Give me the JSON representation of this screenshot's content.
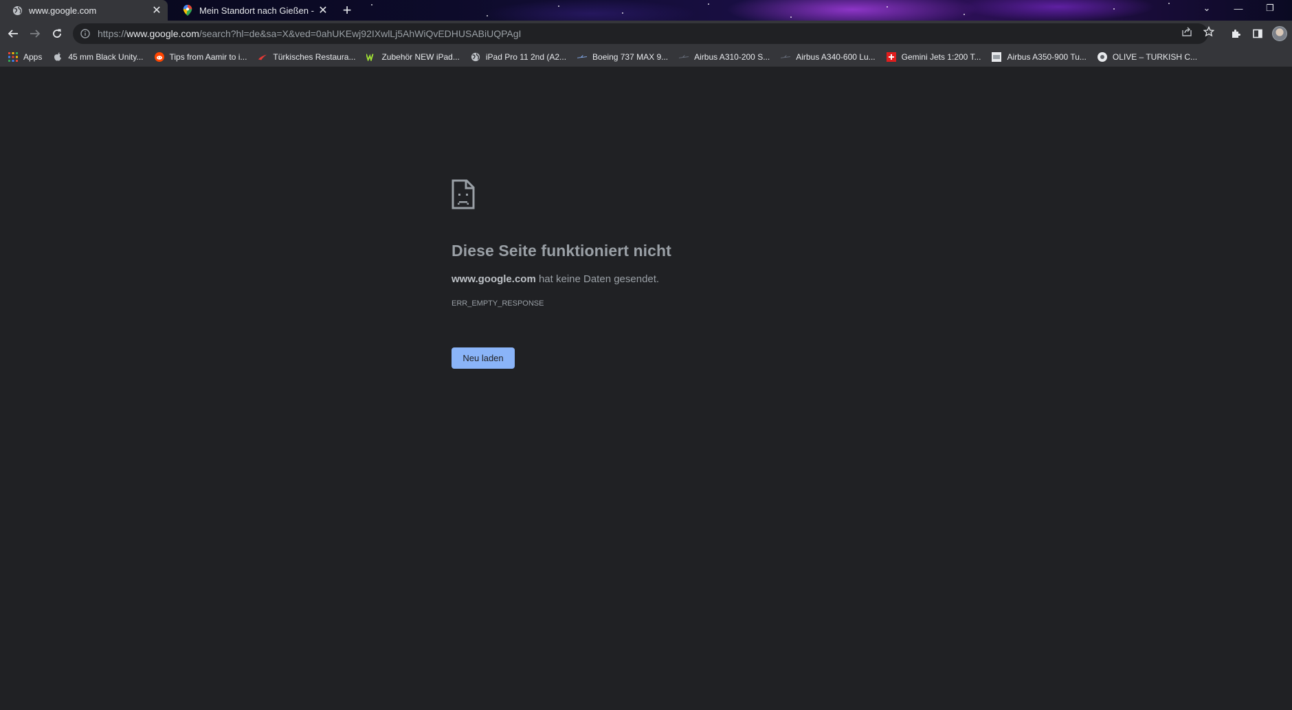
{
  "window": {
    "tabs": [
      {
        "title": "www.google.com",
        "active": true,
        "favicon": "globe-icon",
        "close": "✕"
      },
      {
        "title": "Mein Standort nach Gießen - Goo",
        "active": false,
        "favicon": "google-maps-pin-icon",
        "close": "✕"
      }
    ],
    "new_tab": "+",
    "controls": {
      "tab_search": "⌄",
      "minimize": "—",
      "restore": "❐"
    }
  },
  "toolbar": {
    "url_prefix": "https://",
    "url_host": "www.google.com",
    "url_path": "/search?hl=de&sa=X&ved=0ahUKEwj92IXwlLj5AhWiQvEDHUSABiUQPAgI",
    "icons": [
      "back-icon",
      "forward-icon",
      "reload-icon",
      "info-icon",
      "share-icon",
      "star-icon",
      "extensions-icon",
      "side-panel-icon",
      "profile-avatar"
    ]
  },
  "bookmarks": [
    {
      "label": "Apps",
      "icon": "apps-grid-icon"
    },
    {
      "label": "45 mm Black Unity...",
      "icon": "apple-icon"
    },
    {
      "label": "Tips from Aamir to i...",
      "icon": "reddit-icon"
    },
    {
      "label": "Türkisches Restaura...",
      "icon": "airline-logo-icon"
    },
    {
      "label": "Zubehör NEW iPad...",
      "icon": "w-logo-icon"
    },
    {
      "label": "iPad Pro 11 2nd (A2...",
      "icon": "globe-icon"
    },
    {
      "label": "Boeing 737 MAX 9...",
      "icon": "plane-icon"
    },
    {
      "label": "Airbus A310-200 S...",
      "icon": "plane-icon"
    },
    {
      "label": "Airbus A340-600 Lu...",
      "icon": "plane-icon"
    },
    {
      "label": "Gemini Jets 1:200 T...",
      "icon": "swiss-flag-icon"
    },
    {
      "label": "Airbus A350-900 Tu...",
      "icon": "page-icon"
    },
    {
      "label": "OLIVE – TURKISH C...",
      "icon": "olive-logo-icon"
    }
  ],
  "error_page": {
    "icon": "sad-document-icon",
    "title": "Diese Seite funktioniert nicht",
    "host": "www.google.com",
    "message": " hat keine Daten gesendet.",
    "code": "ERR_EMPTY_RESPONSE",
    "reload_label": "Neu laden"
  },
  "colors": {
    "page_bg": "#202124",
    "toolbar_bg": "#35363a",
    "text_muted": "#9aa0a6",
    "button_blue": "#8ab4f8"
  }
}
